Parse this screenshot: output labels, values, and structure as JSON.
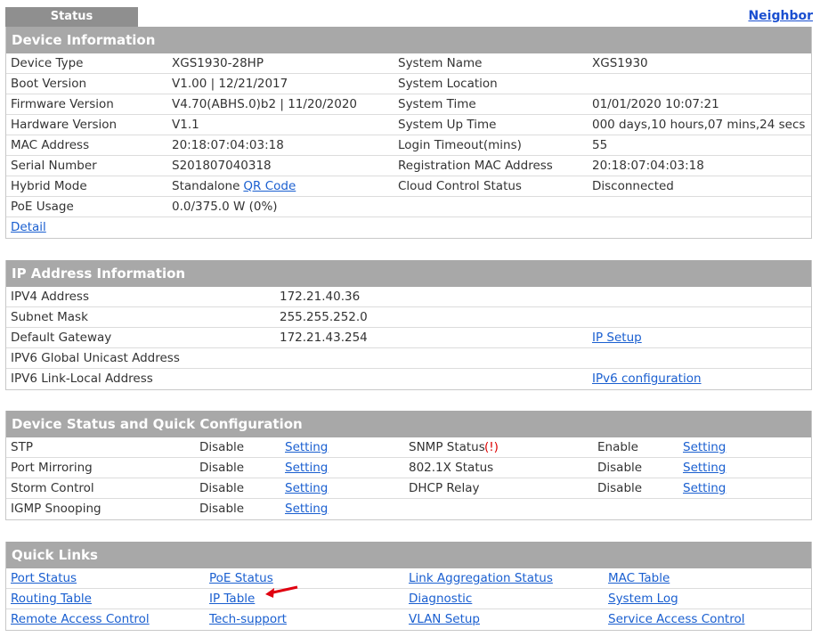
{
  "tab": "Status",
  "neighbor_link": "Neighbor",
  "device_info": {
    "title": "Device Information",
    "rows": [
      [
        "Device Type",
        "XGS1930-28HP",
        "System Name",
        "XGS1930"
      ],
      [
        "Boot Version",
        "V1.00 | 12/21/2017",
        "System Location",
        ""
      ],
      [
        "Firmware Version",
        "V4.70(ABHS.0)b2 | 11/20/2020",
        "System Time",
        "01/01/2020 10:07:21"
      ],
      [
        "Hardware Version",
        "V1.1",
        "System Up Time",
        "000 days,10 hours,07 mins,24 secs"
      ],
      [
        "MAC Address",
        "20:18:07:04:03:18",
        "Login Timeout(mins)",
        "55"
      ],
      [
        "Serial Number",
        "S201807040318",
        "Registration MAC Address",
        "20:18:07:04:03:18"
      ],
      [
        "Hybrid Mode",
        "Standalone",
        "Cloud Control Status",
        "Disconnected"
      ],
      [
        "PoE Usage",
        "0.0/375.0 W (0%)",
        "",
        ""
      ]
    ],
    "qr_link": "QR Code",
    "detail_link": "Detail"
  },
  "ip_info": {
    "title": "IP Address Information",
    "rows": [
      [
        "IPV4 Address",
        "172.21.40.36",
        ""
      ],
      [
        "Subnet Mask",
        "255.255.252.0",
        ""
      ],
      [
        "Default Gateway",
        "172.21.43.254",
        "IP Setup"
      ],
      [
        "IPV6 Global Unicast Address",
        "",
        ""
      ],
      [
        "IPV6 Link-Local Address",
        "",
        "IPv6 configuration"
      ]
    ]
  },
  "quick_config": {
    "title": "Device Status and Quick Configuration",
    "setting": "Setting",
    "snmp_warning": "(!)",
    "rows": [
      [
        "STP",
        "Disable",
        "SNMP Status",
        "Enable"
      ],
      [
        "Port Mirroring",
        "Disable",
        "802.1X Status",
        "Disable"
      ],
      [
        "Storm Control",
        "Disable",
        "DHCP Relay",
        "Disable"
      ],
      [
        "IGMP Snooping",
        "Disable",
        "",
        ""
      ]
    ]
  },
  "quick_links": {
    "title": "Quick Links",
    "rows": [
      [
        "Port Status",
        "PoE Status",
        "Link Aggregation Status",
        "MAC Table"
      ],
      [
        "Routing Table",
        "IP Table",
        "Diagnostic",
        "System Log"
      ],
      [
        "Remote Access Control",
        "Tech-support",
        "VLAN Setup",
        "Service Access Control"
      ]
    ]
  }
}
